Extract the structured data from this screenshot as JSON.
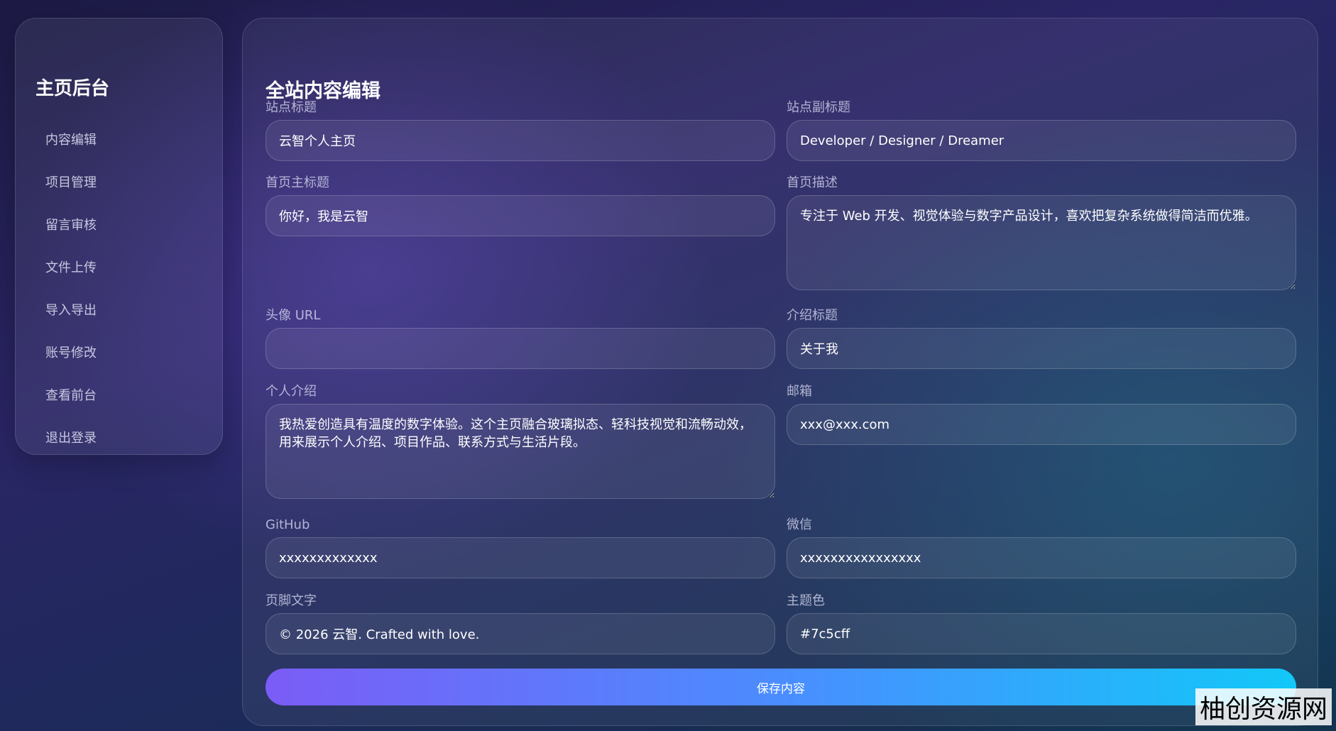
{
  "sidebar": {
    "title": "主页后台",
    "items": [
      {
        "label": "内容编辑"
      },
      {
        "label": "项目管理"
      },
      {
        "label": "留言审核"
      },
      {
        "label": "文件上传"
      },
      {
        "label": "导入导出"
      },
      {
        "label": "账号修改"
      },
      {
        "label": "查看前台"
      },
      {
        "label": "退出登录"
      }
    ]
  },
  "main": {
    "title": "全站内容编辑",
    "fields": {
      "site_title": {
        "label": "站点标题",
        "value": "云智个人主页"
      },
      "site_subtitle": {
        "label": "站点副标题",
        "value": "Developer / Designer / Dreamer"
      },
      "home_heading": {
        "label": "首页主标题",
        "value": "你好，我是云智"
      },
      "home_description": {
        "label": "首页描述",
        "value": "专注于 Web 开发、视觉体验与数字产品设计，喜欢把复杂系统做得简洁而优雅。"
      },
      "avatar_url": {
        "label": "头像 URL",
        "value": ""
      },
      "intro_title": {
        "label": "介绍标题",
        "value": "关于我"
      },
      "personal_intro": {
        "label": "个人介绍",
        "value": "我热爱创造具有温度的数字体验。这个主页融合玻璃拟态、轻科技视觉和流畅动效，用来展示个人介绍、项目作品、联系方式与生活片段。"
      },
      "email": {
        "label": "邮箱",
        "value": "xxx@xxx.com"
      },
      "github": {
        "label": "GitHub",
        "value": "xxxxxxxxxxxxx"
      },
      "wechat": {
        "label": "微信",
        "value": "xxxxxxxxxxxxxxxx"
      },
      "footer_text": {
        "label": "页脚文字",
        "value": "© 2026 云智. Crafted with love."
      },
      "theme_color": {
        "label": "主题色",
        "value": "#7c5cff"
      }
    },
    "save_label": "保存内容"
  },
  "watermark": "柚创资源网",
  "colors": {
    "accent_start": "#7b5cf6",
    "accent_end": "#12c8f8"
  }
}
